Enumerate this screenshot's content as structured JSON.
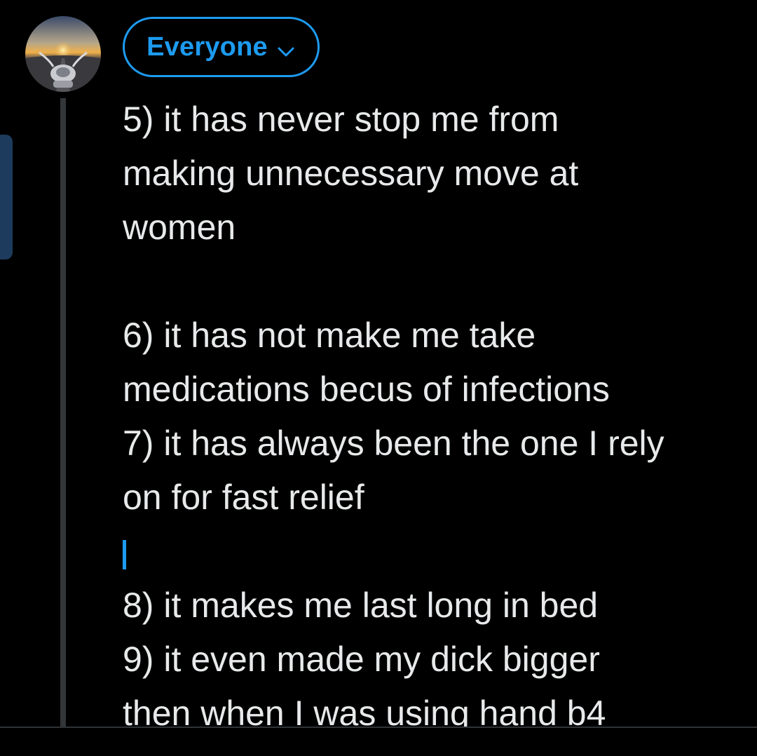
{
  "audience": {
    "label": "Everyone",
    "icon": "chevron-down-icon",
    "color": "#1d9bf0"
  },
  "avatar": {
    "description_icon": "motorcycle-sunset-avatar"
  },
  "compose": {
    "lines": [
      "5) it has  never stop me from",
      "making unnecessary move at",
      "women",
      "",
      "6) it has not make me take",
      "medications becus of infections",
      "7) it has always been the one I rely",
      "on for fast relief",
      "",
      "8) it makes me last long in bed",
      "9) it even made my dick bigger",
      "then when I was using hand b4"
    ]
  },
  "colors": {
    "background": "#000000",
    "text": "#e7e9ea",
    "accent": "#1d9bf0",
    "thread_line": "#333639"
  }
}
